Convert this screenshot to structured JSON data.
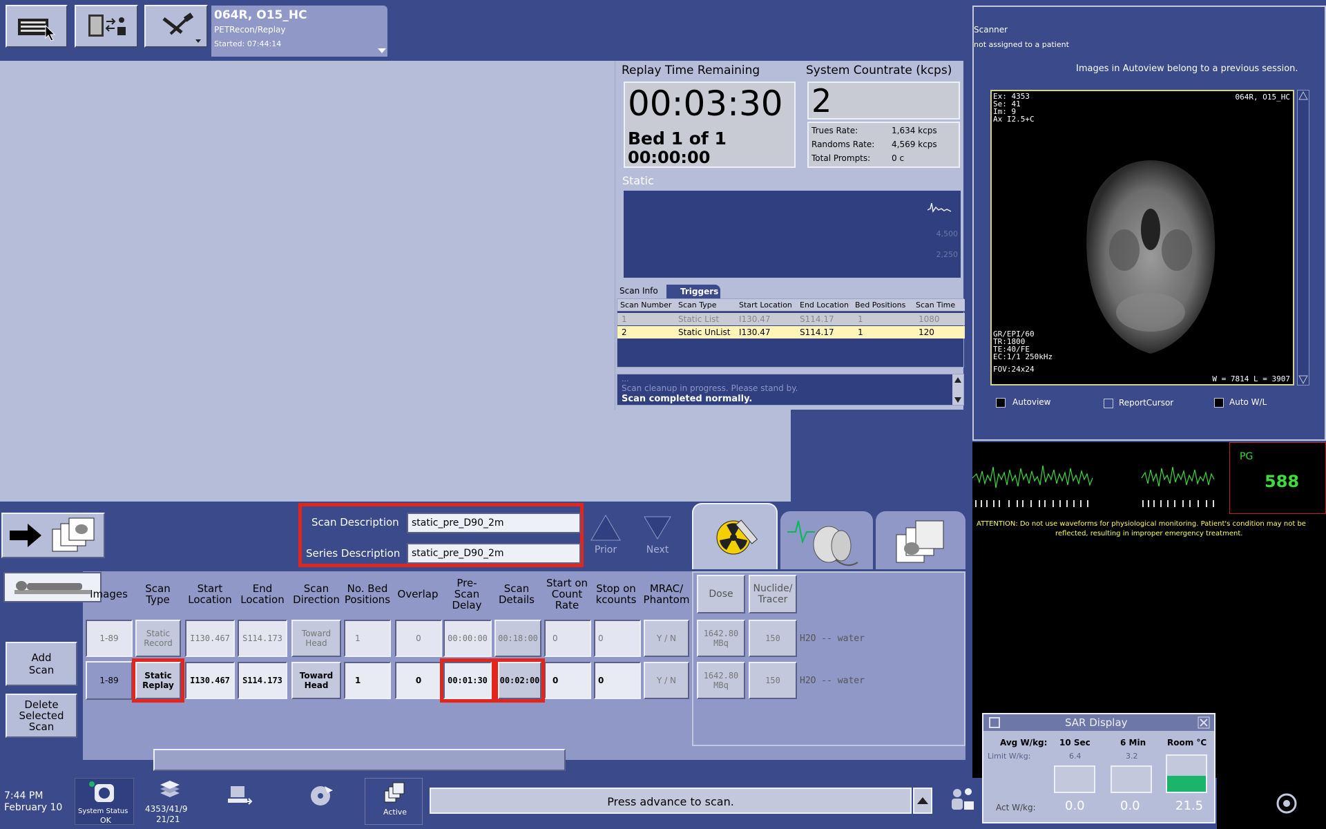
{
  "toolbar": {
    "exam_title": "064R, O15_HC",
    "exam_app": "PETRecon/Replay",
    "exam_started": "Started: 07:44:14"
  },
  "replay": {
    "time_remaining_label": "Replay Time Remaining",
    "time_remaining_value": "00:03:30",
    "bed_label": "Bed 1 of 1",
    "bed_time": "00:00:00",
    "countrate_label": "System Countrate (kcps)",
    "countrate_value": "2",
    "trues_label": "Trues Rate:",
    "trues_value": "1,634 kcps",
    "randoms_label": "Randoms Rate:",
    "randoms_value": "4,569 kcps",
    "prompts_label": "Total Prompts:",
    "prompts_value": "0 c",
    "static_label": "Static",
    "graph_tick_1": "4,500",
    "graph_tick_2": "2,250"
  },
  "scan_info": {
    "tab_info": "Scan Info",
    "tab_triggers": "Triggers",
    "headers": [
      "Scan Number",
      "Scan Type",
      "Start Location",
      "End Location",
      "Bed Positions",
      "Scan Time"
    ],
    "rows": [
      [
        "1",
        "Static List",
        "I130.47",
        "S114.17",
        "1",
        "1080"
      ],
      [
        "2",
        "Static UnList",
        "I130.47",
        "S114.17",
        "1",
        "120"
      ]
    ],
    "msg_1": "...",
    "msg_2": "Scan cleanup in progress.  Please stand by.",
    "msg_3": "Scan completed normally."
  },
  "description": {
    "scan_label": "Scan Description",
    "scan_value": "static_pre_D90_2m",
    "series_label": "Series Description",
    "series_value": "static_pre_D90_2m",
    "prior_label": "Prior",
    "next_label": "Next"
  },
  "grid": {
    "headers": {
      "images": "Images",
      "scan_type": "Scan\nType",
      "start_loc": "Start\nLocation",
      "end_loc": "End\nLocation",
      "direction": "Scan\nDirection",
      "bed_positions": "No. Bed\nPositions",
      "overlap": "Overlap",
      "prescan": "Pre-\nScan\nDelay",
      "details": "Scan\nDetails",
      "count_rate": "Start on\nCount\nRate",
      "stop_kcounts": "Stop on\nkcounts",
      "mrac": "MRAC/\nPhantom",
      "dose": "Dose",
      "nuclide": "Nuclide/\nTracer"
    },
    "rows": [
      {
        "images": "1-89",
        "scan_type": "Static\nRecord",
        "start": "I130.467",
        "end": "S114.173",
        "direction": "Toward\nHead",
        "bed": "1",
        "overlap": "0",
        "prescan": "00:00:00",
        "details": "00:18:00",
        "count_rate": "0",
        "stop": "0",
        "mrac": "Y / N",
        "dose": "1642.80\nMBq",
        "nuclide": "150",
        "tracer": "H2O -- water"
      },
      {
        "images": "1-89",
        "scan_type": "Static\nReplay",
        "start": "I130.467",
        "end": "S114.173",
        "direction": "Toward\nHead",
        "bed": "1",
        "overlap": "0",
        "prescan": "00:01:30",
        "details": "00:02:00",
        "count_rate": "0",
        "stop": "0",
        "mrac": "Y / N",
        "dose": "1642.80\nMBq",
        "nuclide": "150",
        "tracer": "H2O -- water"
      }
    ],
    "add_scan": "Add\nScan",
    "delete_scan": "Delete\nSelected\nScan"
  },
  "viewer": {
    "scanner_label": "Scanner",
    "patient_status": "not assigned to a patient",
    "autoview_notice": "Images in Autoview belong to a previous session.",
    "overlay_tl": [
      "Ex: 4353",
      "Se: 41",
      "Im: 9",
      "Ax I2.5+C"
    ],
    "overlay_tr": "064R, O15_HC",
    "overlay_bl": [
      "GR/EPI/60",
      "TR:1800",
      "TE:40/FE",
      "EC:1/1 250kHz",
      "FOV:24x24"
    ],
    "overlay_br": "W =  7814 L =  3907",
    "autoview_label": "Autoview",
    "report_cursor_label": "ReportCursor",
    "auto_wl_label": "Auto W/L"
  },
  "physio": {
    "pg_label": "PG",
    "pg_value": "588",
    "attention_1": "ATTENTION: Do not use waveforms for physiological monitoring. Patient's condition may not be",
    "attention_2": "reflected, resulting in improper emergency treatment."
  },
  "sar": {
    "title": "SAR Display",
    "avg_label": "Avg W/kg:",
    "limit_label": "Limit W/kg:",
    "act_label": "Act W/kg:",
    "col_10s": "10 Sec",
    "col_6m": "6 Min",
    "col_room": "Room °C",
    "limit_10s": "6.4",
    "limit_6m": "3.2",
    "act_10s": "0.0",
    "act_6m": "0.0",
    "room_temp": "21.5",
    "room_level": 0.45
  },
  "status_bar": {
    "time": "7:44 PM",
    "date": "February 10",
    "system_status_label": "System Status",
    "system_status_value": "OK",
    "image_count_1": "4353/41/9",
    "image_count_2": "21/21",
    "active_label": "Active",
    "message": "Press advance to scan."
  }
}
